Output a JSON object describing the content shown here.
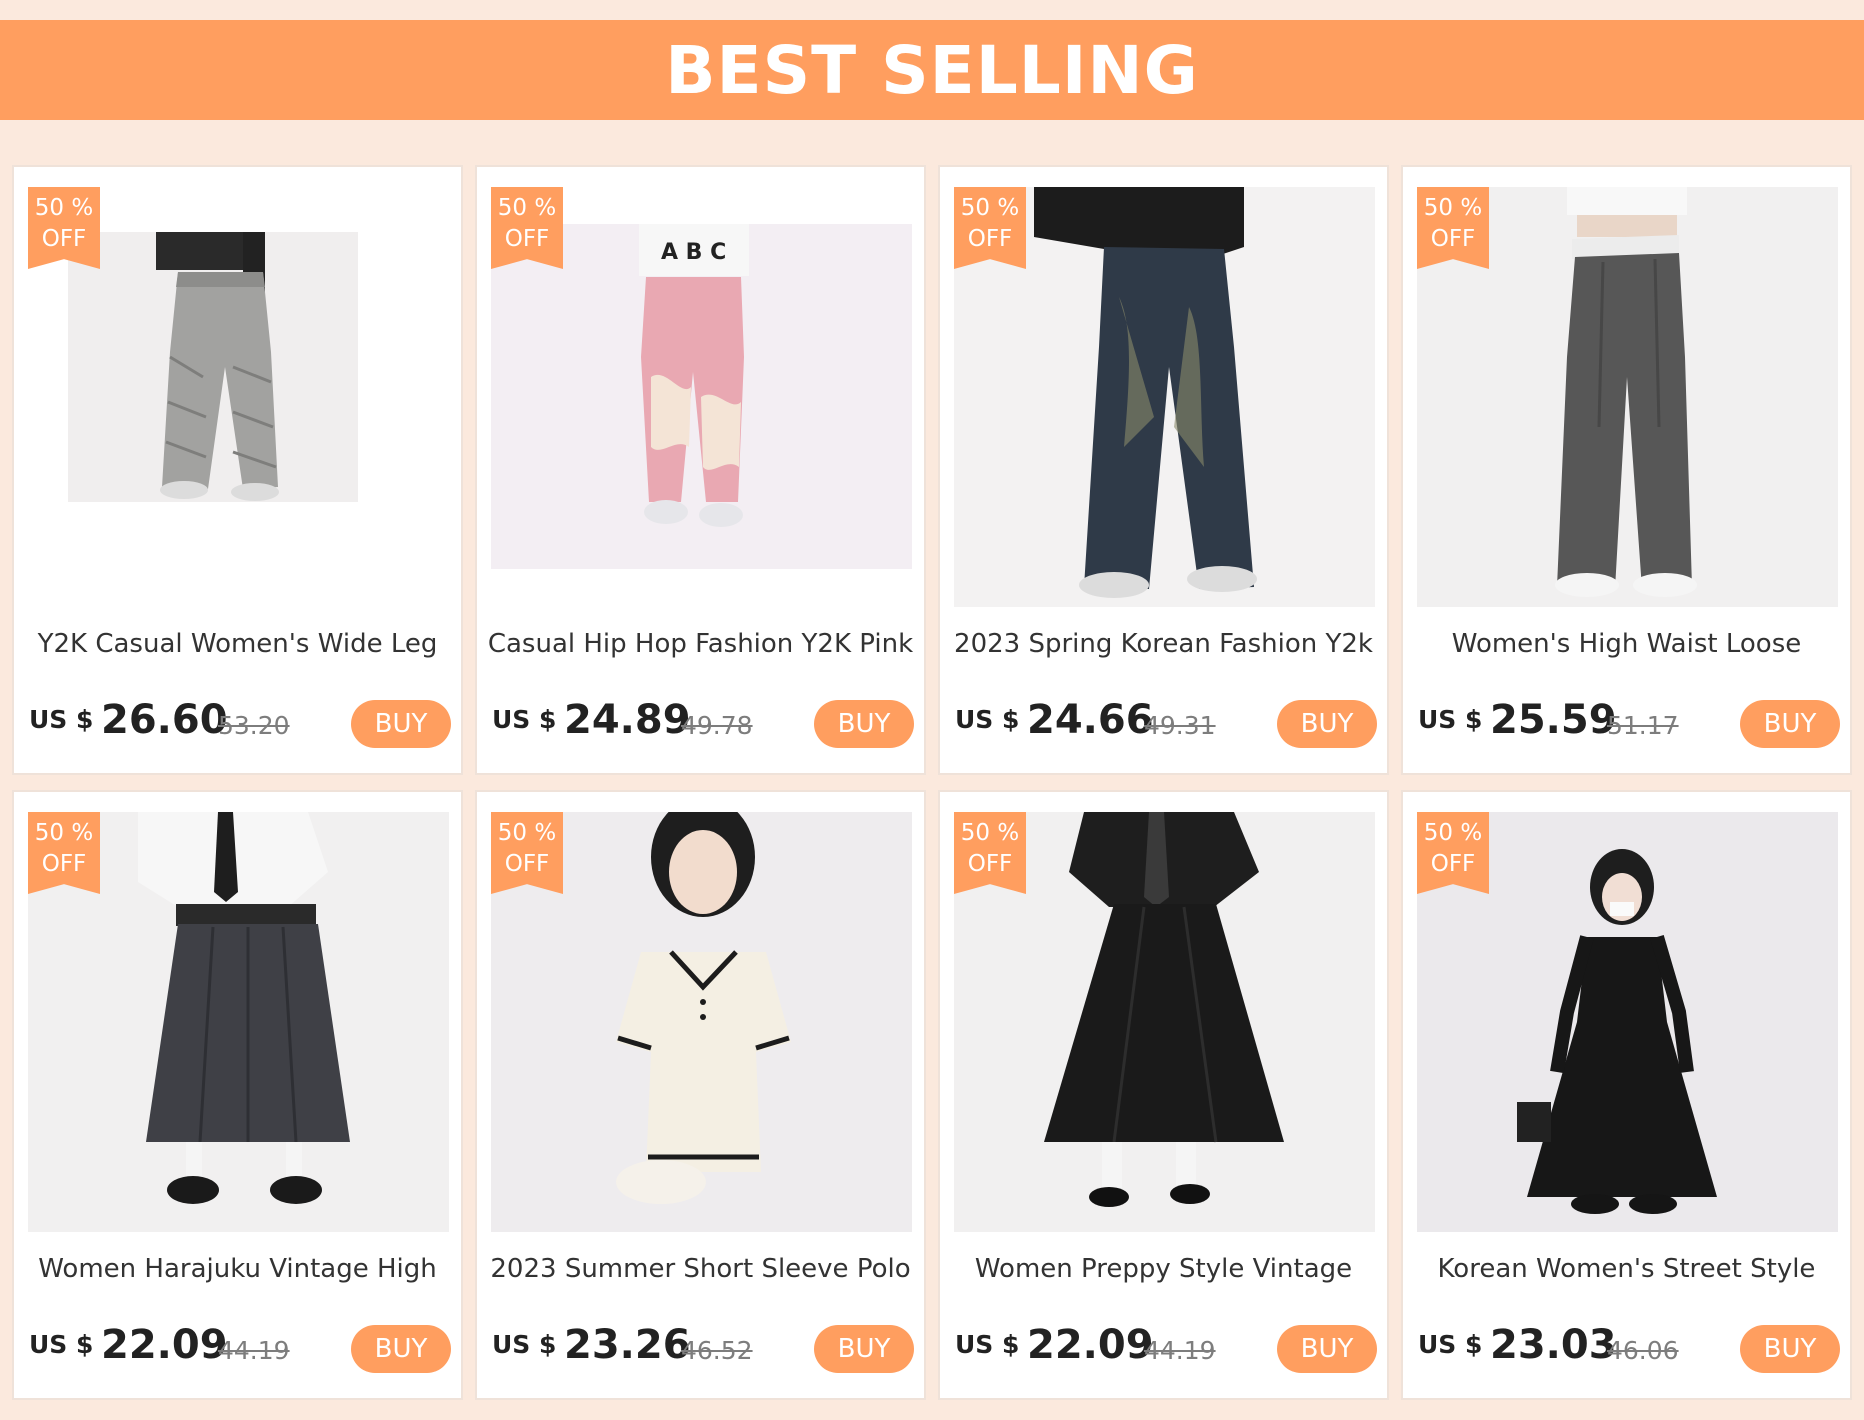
{
  "banner": {
    "title": "BEST SELLING"
  },
  "colors": {
    "accent": "#ff9e5f",
    "page_background": "#fbe9dd",
    "card_border": "#efe2d9"
  },
  "products": [
    {
      "badge_line1": "50 %",
      "badge_line2": "OFF",
      "name": "Y2K Casual Women's Wide Leg",
      "currency": "US $",
      "price": "26.60",
      "old_price": "53.20",
      "buy_label": "BUY",
      "image_icon": "grey-parachute-pants-photo"
    },
    {
      "badge_line1": "50 %",
      "badge_line2": "OFF",
      "name": "Casual Hip Hop Fashion Y2K Pink",
      "currency": "US $",
      "price": "24.89",
      "old_price": "49.78",
      "buy_label": "BUY",
      "image_icon": "pink-jeans-photo"
    },
    {
      "badge_line1": "50 %",
      "badge_line2": "OFF",
      "name": "2023 Spring Korean Fashion Y2k",
      "currency": "US $",
      "price": "24.66",
      "old_price": "49.31",
      "buy_label": "BUY",
      "image_icon": "baggy-denim-jeans-photo"
    },
    {
      "badge_line1": "50 %",
      "badge_line2": "OFF",
      "name": "Women's High Waist Loose",
      "currency": "US $",
      "price": "25.59",
      "old_price": "51.17",
      "buy_label": "BUY",
      "image_icon": "grey-wide-trousers-photo"
    },
    {
      "badge_line1": "50 %",
      "badge_line2": "OFF",
      "name": "Women Harajuku Vintage High",
      "currency": "US $",
      "price": "22.09",
      "old_price": "44.19",
      "buy_label": "BUY",
      "image_icon": "pleated-skirt-outfit-photo"
    },
    {
      "badge_line1": "50 %",
      "badge_line2": "OFF",
      "name": "2023 Summer Short Sleeve Polo",
      "currency": "US $",
      "price": "23.26",
      "old_price": "46.52",
      "buy_label": "BUY",
      "image_icon": "white-polo-dress-photo"
    },
    {
      "badge_line1": "50 %",
      "badge_line2": "OFF",
      "name": "Women Preppy Style Vintage",
      "currency": "US $",
      "price": "22.09",
      "old_price": "44.19",
      "buy_label": "BUY",
      "image_icon": "black-midi-skirt-photo"
    },
    {
      "badge_line1": "50 %",
      "badge_line2": "OFF",
      "name": "Korean Women's Street Style",
      "currency": "US $",
      "price": "23.03",
      "old_price": "46.06",
      "buy_label": "BUY",
      "image_icon": "black-long-dress-photo"
    }
  ]
}
